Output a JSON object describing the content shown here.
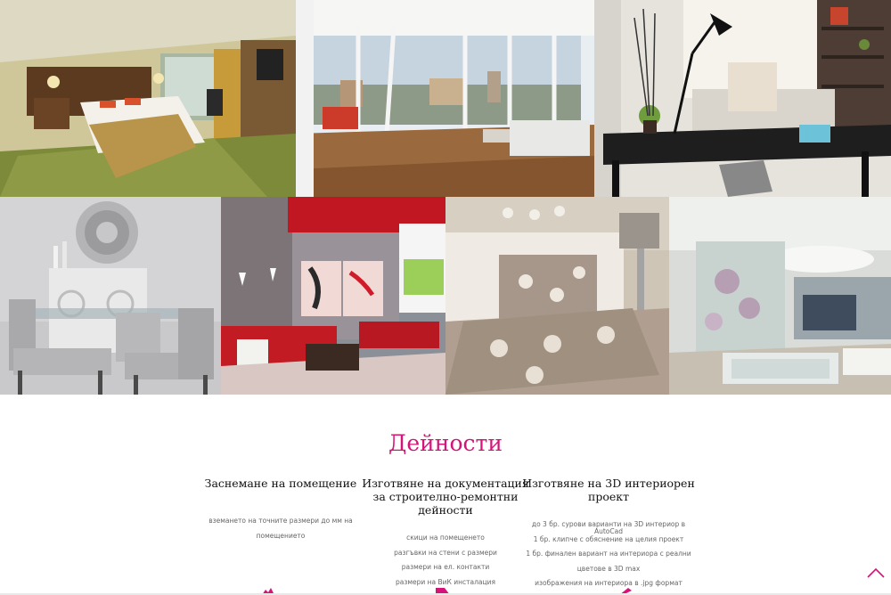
{
  "gallery": {
    "images": [
      {
        "name": "hotel-room-photo"
      },
      {
        "name": "open-living-room-photo"
      },
      {
        "name": "home-office-photo"
      },
      {
        "name": "dining-room-photo"
      },
      {
        "name": "red-living-room-photo"
      },
      {
        "name": "bedroom-photo"
      },
      {
        "name": "bathroom-photo"
      }
    ]
  },
  "activities": {
    "title": "Дейности",
    "columns": [
      {
        "title": "Заснемане на помещение",
        "items": [
          "вземането на точните размери до мм на помещението"
        ]
      },
      {
        "title": "Изготвяне на документация за строително-ремонтни дейности",
        "items": [
          "скици на помещенето",
          "разгъвки на стени с размери",
          "размери на ел. контакти",
          "размери на ВиК инсталация"
        ]
      },
      {
        "title": "Изготвяне на 3D интериорен проект",
        "items": [
          "до 3 бр. сурови варианти на 3D интериор в AutoCad",
          "1 бр. клипче с обяснение на целия проект",
          "1 бр. финален вариант на интериора с реални",
          "цветове в 3D max",
          "изображения на интериора в .jpg формат"
        ]
      }
    ]
  },
  "colors": {
    "accent": "#d5147a"
  },
  "icons": [
    "measure-icon",
    "document-icon",
    "pencil-icon",
    "chevron-up-icon"
  ]
}
